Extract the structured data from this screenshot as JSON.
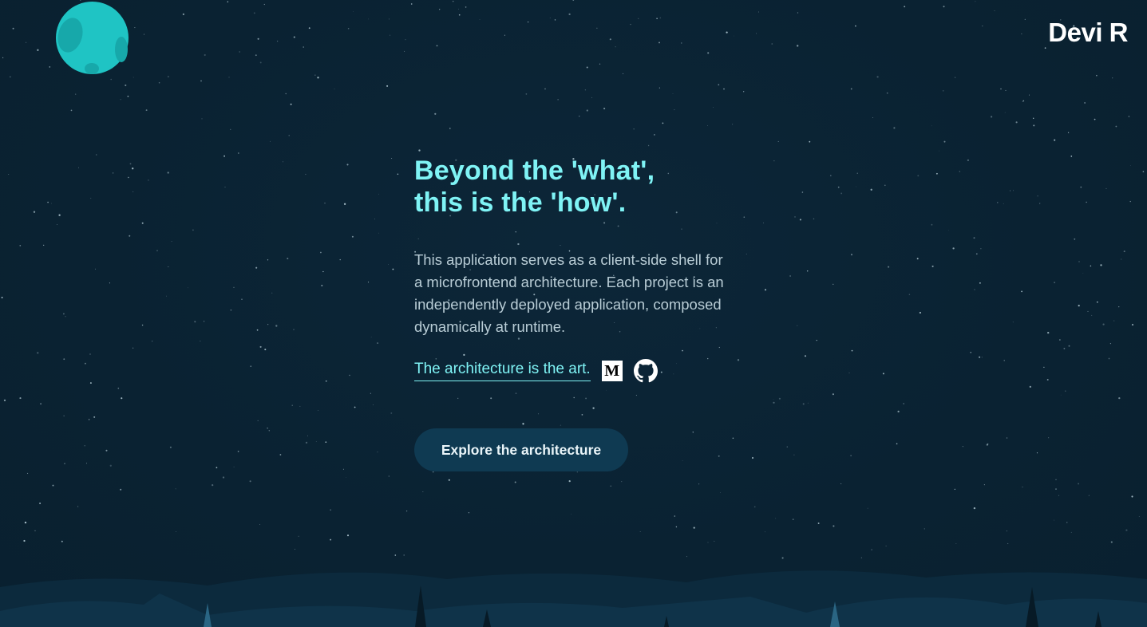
{
  "brand": {
    "name": "Devi R"
  },
  "hero": {
    "headline_line1": "Beyond the 'what',",
    "headline_line2": "this is the 'how'.",
    "description": "This application serves as a client-side shell for a microfrontend architecture. Each project is an independently deployed application, composed dynamically at runtime.",
    "art_link_label": "The architecture is the art.",
    "medium_icon": "medium-icon",
    "medium_glyph": "M",
    "github_icon": "github-icon"
  },
  "cta": {
    "label": "Explore the architecture"
  },
  "colors": {
    "background": "#0a2232",
    "accent": "#7ff3f5",
    "moon": "#1fc4c4",
    "button": "#0f3a52"
  }
}
